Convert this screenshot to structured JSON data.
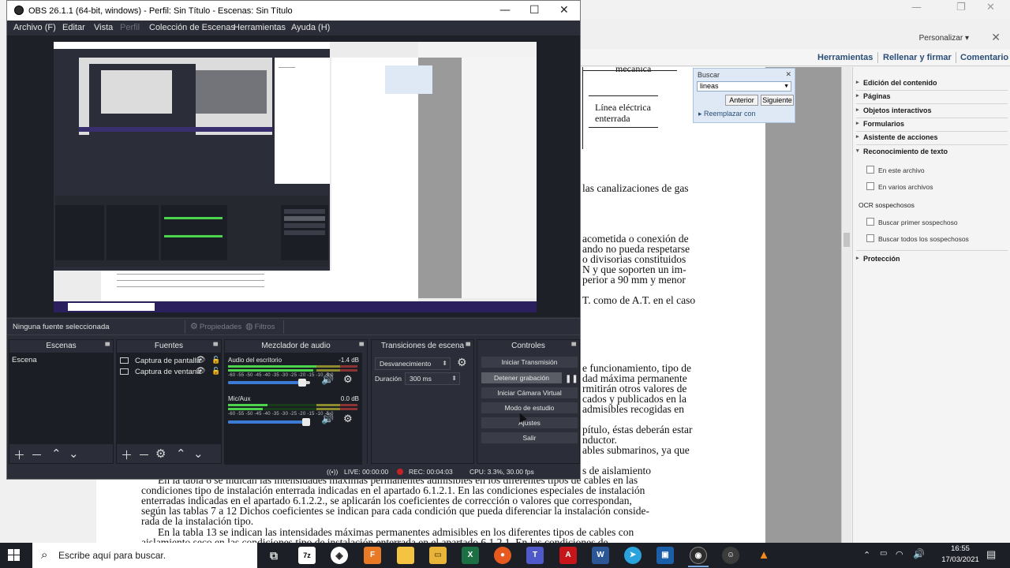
{
  "obs": {
    "title": "OBS 26.1.1 (64-bit, windows) - Perfil: Sin Título - Escenas: Sin Título",
    "menu": [
      "Archivo (F)",
      "Editar",
      "Vista",
      "Perfil",
      "Colección de Escenas",
      "Herramientas",
      "Ayuda (H)"
    ],
    "status_bar": {
      "no_source": "Ninguna fuente seleccionada",
      "properties": "Propiedades",
      "filters": "Filtros"
    },
    "docks": {
      "scenes": {
        "title": "Escenas",
        "items": [
          "Escena"
        ]
      },
      "sources": {
        "title": "Fuentes",
        "items": [
          "Captura de pantalla",
          "Captura de ventana"
        ]
      },
      "mixer": {
        "title": "Mezclador de audio",
        "scale": "-60 -55 -50 -45 -40 -35 -30 -25 -20 -15 -10 -5 0",
        "channels": [
          {
            "name": "Audio del escritorio",
            "db": "-1.4 dB",
            "volume": 0.95
          },
          {
            "name": "Mic/Aux",
            "db": "0.0 dB",
            "volume": 1.0
          }
        ]
      },
      "transitions": {
        "title": "Transiciones de escena",
        "selected": "Desvanecimiento",
        "duration_label": "Duración",
        "duration_value": "300 ms"
      },
      "controls": {
        "title": "Controles",
        "buttons": [
          "Iniciar Transmisión",
          "Detener grabación",
          "Iniciar Cámara Virtual",
          "Modo de estudio",
          "Ajustes",
          "Salir"
        ]
      }
    },
    "footer": {
      "live": "LIVE: 00:00:00",
      "rec": "REC: 00:04:03",
      "cpu": "CPU: 3.3%, 30.00 fps"
    }
  },
  "pdf": {
    "personalizar": "Personalizar",
    "tools": [
      "Herramientas",
      "Rellenar y firmar",
      "Comentario"
    ],
    "search": {
      "title": "Buscar",
      "value": "lineas",
      "prev": "Anterior",
      "next": "Siguiente",
      "replace": "Reemplazar con"
    },
    "panel": {
      "sections": [
        "Edición del contenido",
        "Páginas",
        "Objetos interactivos",
        "Formularios",
        "Asistente de acciones",
        "Reconocimiento de texto"
      ],
      "ocr_items": [
        "En este archivo",
        "En varios archivos"
      ],
      "ocr_suspects_title": "OCR sospechosos",
      "ocr_suspects": [
        "Buscar primer sospechoso",
        "Buscar todos los sospechosos"
      ],
      "protection": "Protección"
    },
    "figure": {
      "line1": "Línea eléctrica",
      "line2": "enterrada",
      "top_word": "mecánica"
    },
    "right_text": [
      "las canalizaciones de gas",
      "acometida o conexión de",
      "ando no pueda respetarse",
      "o divisorias constituidos",
      "N y que soporten un im-",
      "perior a 90 mm y menor",
      "T. como de A.T. en el caso",
      "e funcionamiento, tipo de",
      "dad máxima permanente",
      "rmitirán otros valores de",
      "cados y publicados en la",
      "admisibles recogidas en",
      "pítulo, éstas deberán estar",
      "nductor.",
      "ables submarinos, ya que",
      "s de aislamiento"
    ],
    "bottom_text": [
      "En la tabla 6 se indican las intensidades máximas permanentes admisibles en los diferentes tipos de cables en las",
      "condiciones tipo de instalación enterrada indicadas en el apartado 6.1.2.1. En las condiciones especiales de instalación",
      "enterradas indicadas en el apartado 6.1.2.2., se aplicarán los coeficientes de corrección o valores que correspondan,",
      "según las tablas 7 a 12 Dichos coeficientes se indican para cada condición que pueda diferenciar la instalación conside-",
      "rada de la instalación tipo.",
      "En la tabla 13 se indican las intensidades máximas permanentes admisibles en los diferentes tipos de cables con",
      "aislamiento seco en las condiciones tipo de instalación enterrada en el apartado 6.1.2.1. En las condiciones de"
    ]
  },
  "taskbar": {
    "search_placeholder": "Escribe aquí para buscar.",
    "time": "16:55",
    "date": "17/03/2021",
    "apps": [
      "task-view",
      "7zip",
      "obs-app",
      "foxit",
      "file-explorer",
      "excel",
      "firefox",
      "teams",
      "acrobat",
      "word",
      "telegram",
      "virtualbox",
      "obs-app-2",
      "discord-like",
      "vlc"
    ]
  }
}
